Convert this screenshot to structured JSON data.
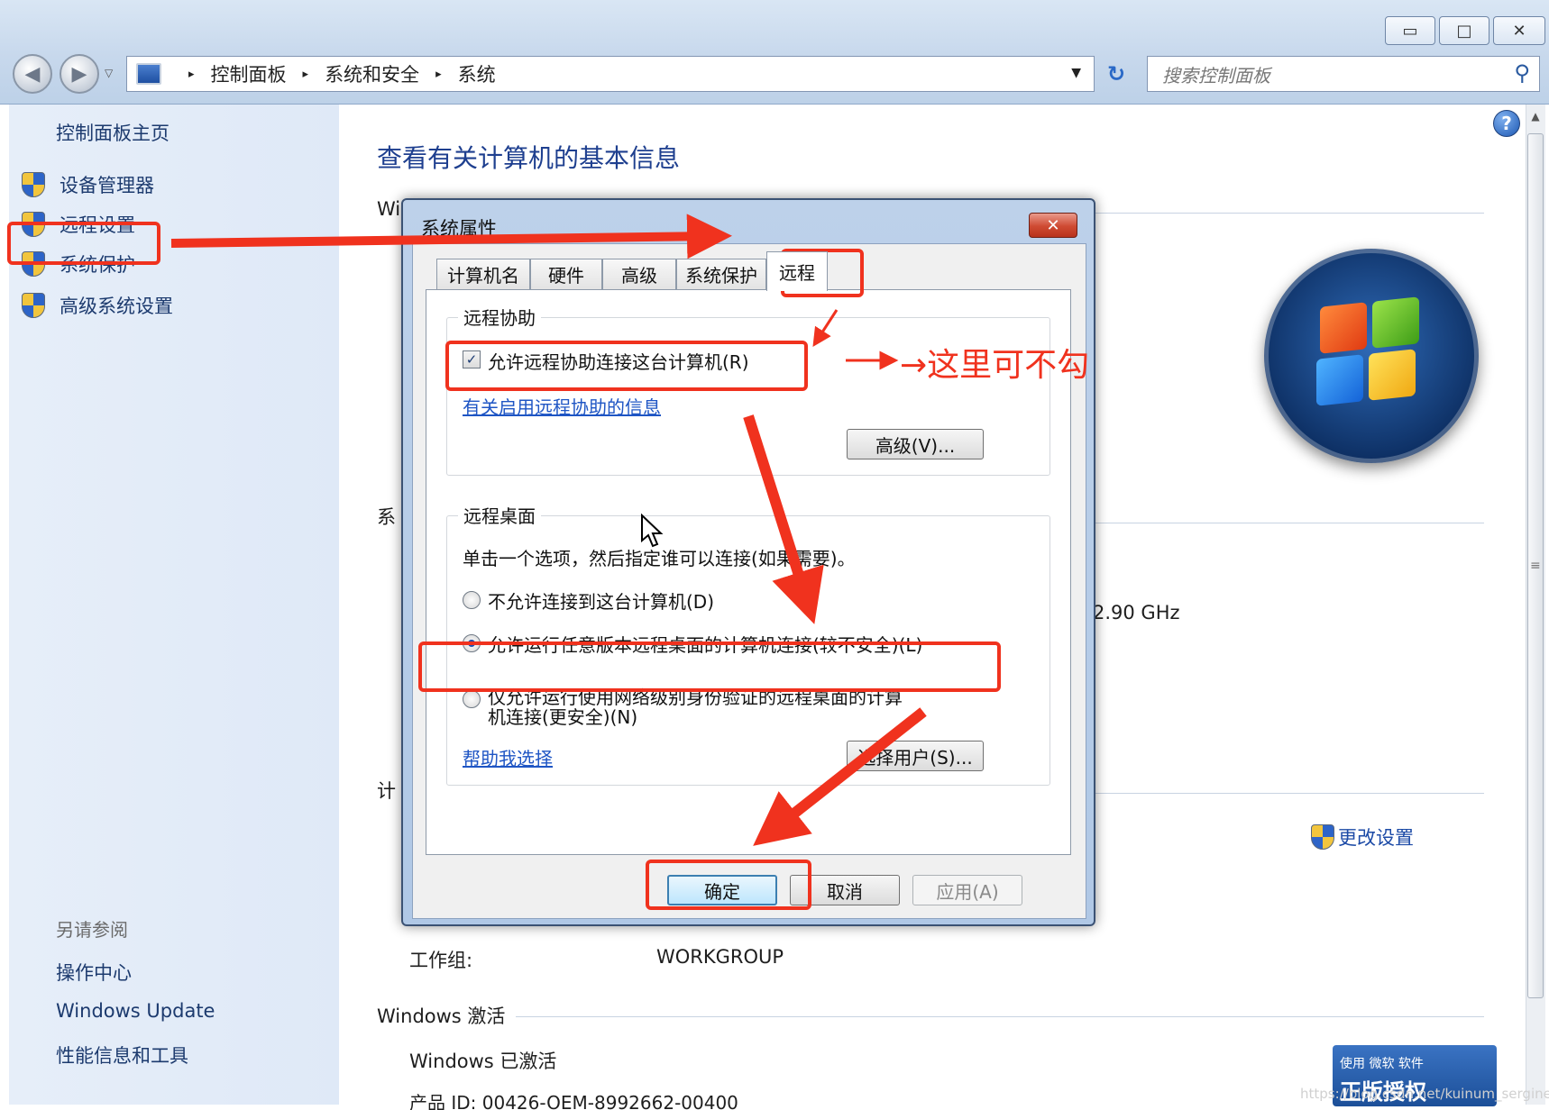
{
  "window": {
    "min_icon": "minimize-icon",
    "max_icon": "maximize-icon",
    "close_icon": "close-icon",
    "min_glyph": "▭",
    "max_glyph": "□",
    "close_glyph": "✕"
  },
  "nav": {
    "back_glyph": "◀",
    "forward_glyph": "▶",
    "dropdown_glyph": "▽"
  },
  "address": {
    "crumbs": [
      "控制面板",
      "系统和安全",
      "系统"
    ],
    "separator": "▸",
    "dropdown_glyph": "▼",
    "refresh_glyph": "↻"
  },
  "search": {
    "placeholder": "搜索控制面板",
    "icon_glyph": "⚲"
  },
  "sidebar": {
    "home": "控制面板主页",
    "items": [
      {
        "label": "设备管理器"
      },
      {
        "label": "远程设置"
      },
      {
        "label": "系统保护"
      },
      {
        "label": "高级系统设置"
      }
    ],
    "see_also_title": "另请参阅",
    "see_also": [
      "操作中心",
      "Windows Update",
      "性能信息和工具"
    ]
  },
  "main": {
    "title": "查看有关计算机的基本信息",
    "partial_section_1": "Wi",
    "partial_section_2": "系",
    "partial_section_3": "计",
    "cpu_speed": "2.90 GHz",
    "workgroup_label": "工作组:",
    "workgroup_value": "WORKGROUP",
    "activation_section": "Windows 激活",
    "activated_text": "Windows 已激活",
    "product_id": "产品 ID: 00426-OEM-8992662-00400",
    "change_settings": "更改设置",
    "help_glyph": "?",
    "genuine_line1": "使用 微软 软件",
    "genuine_line2": "正版授权",
    "watermark": "https://blog.csdn.net/kuinum_sergine"
  },
  "dialog": {
    "title": "系统属性",
    "close_glyph": "✕",
    "tabs": [
      "计算机名",
      "硬件",
      "高级",
      "系统保护",
      "远程"
    ],
    "active_tab": "远程",
    "remote_assist": {
      "group_title": "远程协助",
      "checkbox_label": "允许远程协助连接这台计算机(R)",
      "checked": true,
      "check_glyph": "✓",
      "info_link": "有关启用远程协助的信息",
      "advanced_button": "高级(V)..."
    },
    "remote_desktop": {
      "group_title": "远程桌面",
      "instruction": "单击一个选项，然后指定谁可以连接(如果需要)。",
      "options": [
        {
          "label": "不允许连接到这台计算机(D)",
          "checked": false
        },
        {
          "label": "允许运行任意版本远程桌面的计算机连接(较不安全)(L)",
          "checked": true
        },
        {
          "label_line1": "仅允许运行使用网络级别身份验证的远程桌面的计算",
          "label_line2": "机连接(更安全)(N)",
          "checked": false
        }
      ],
      "help_link": "帮助我选择",
      "select_users_button": "选择用户(S)..."
    },
    "buttons": {
      "ok": "确定",
      "cancel": "取消",
      "apply": "应用(A)"
    }
  },
  "annotations": {
    "note": "→这里可不勾",
    "color": "#f0321e"
  }
}
